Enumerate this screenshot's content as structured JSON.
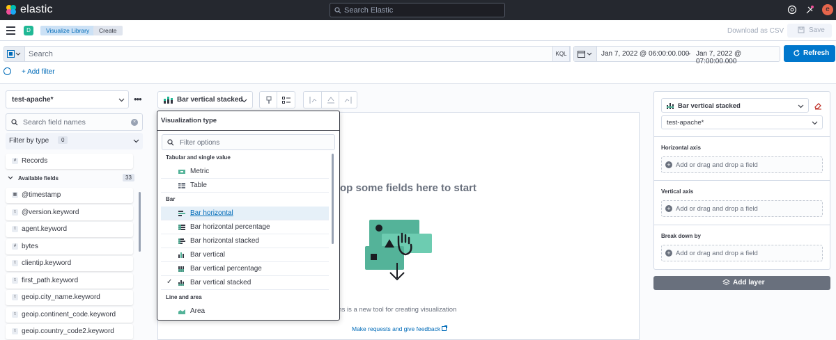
{
  "topbar": {
    "brand": "elastic",
    "search_placeholder": "Search Elastic",
    "avatar_letter": "e"
  },
  "breadcrumbs": {
    "space": "D",
    "items": [
      "Visualize Library",
      "Create"
    ]
  },
  "actions": {
    "download_csv": "Download as CSV",
    "save": "Save"
  },
  "query": {
    "placeholder": "Search",
    "language": "KQL",
    "date_start": "Jan 7, 2022 @ 06:00:00.000",
    "date_arrow": "→",
    "date_end": "Jan 7, 2022 @ 07:00:00.000",
    "refresh": "Refresh",
    "add_filter": "+ Add filter"
  },
  "sidebar": {
    "index_pattern": "test-apache*",
    "search_placeholder": "Search field names",
    "filter_by_type": "Filter by type",
    "filter_count": "0",
    "records_label": "Records",
    "available_label": "Available fields",
    "available_count": "33",
    "fields": [
      {
        "name": "@timestamp",
        "type": "date"
      },
      {
        "name": "@version.keyword",
        "type": "t"
      },
      {
        "name": "agent.keyword",
        "type": "t"
      },
      {
        "name": "bytes",
        "type": "#"
      },
      {
        "name": "clientip.keyword",
        "type": "t"
      },
      {
        "name": "first_path.keyword",
        "type": "t"
      },
      {
        "name": "geoip.city_name.keyword",
        "type": "t"
      },
      {
        "name": "geoip.continent_code.keyword",
        "type": "t"
      },
      {
        "name": "geoip.country_code2.keyword",
        "type": "t"
      }
    ]
  },
  "workspace": {
    "vis_type_button": "Bar vertical stacked",
    "drop_title": "op some fields here to start",
    "lens_text": "ens is a new tool for creating visualization",
    "feedback": "Make requests and give feedback"
  },
  "popover": {
    "title": "Visualization type",
    "filter_placeholder": "Filter options",
    "groups": {
      "tabular": "Tabular and single value",
      "bar": "Bar",
      "line": "Line and area"
    },
    "options": {
      "metric": "Metric",
      "table": "Table",
      "bar_horizontal": "Bar horizontal",
      "bar_horizontal_pct": "Bar horizontal percentage",
      "bar_horizontal_stacked": "Bar horizontal stacked",
      "bar_vertical": "Bar vertical",
      "bar_vertical_pct": "Bar vertical percentage",
      "bar_vertical_stacked": "Bar vertical stacked",
      "area": "Area"
    },
    "selected_mark": "✓"
  },
  "config": {
    "vis_type": "Bar vertical stacked",
    "index_pattern": "test-apache*",
    "horizontal_axis": "Horizontal axis",
    "vertical_axis": "Vertical axis",
    "break_down_by": "Break down by",
    "drop_hint": "Add or drag and drop a field",
    "add_layer": "Add layer"
  },
  "colors": {
    "accent": "#0077cc",
    "chart_green": "#54b399",
    "topbar": "#25282f"
  }
}
